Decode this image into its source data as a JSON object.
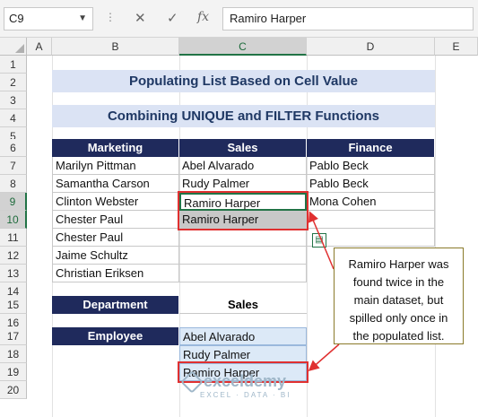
{
  "formula_bar": {
    "name_box": "C9",
    "cancel_glyph": "✕",
    "enter_glyph": "✓",
    "fx_label": "fx",
    "content": "Ramiro Harper"
  },
  "columns": [
    "A",
    "B",
    "C",
    "D",
    "E"
  ],
  "rows": [
    "1",
    "2",
    "3",
    "4",
    "5",
    "6",
    "7",
    "8",
    "9",
    "10",
    "11",
    "12",
    "13",
    "14",
    "15",
    "16",
    "17",
    "18",
    "19",
    "20"
  ],
  "titles": {
    "main": "Populating List Based on Cell Value",
    "sub": "Combining UNIQUE and FILTER Functions"
  },
  "table": {
    "headers": [
      "Marketing",
      "Sales",
      "Finance"
    ],
    "marketing": [
      "Marilyn Pittman",
      "Samantha Carson",
      "Clinton Webster",
      "Chester Paul",
      "Chester Paul",
      "Jaime Schultz",
      "Christian Eriksen"
    ],
    "sales": [
      "Abel Alvarado",
      "Rudy Palmer",
      "Ramiro Harper",
      "Ramiro Harper",
      "",
      "",
      ""
    ],
    "finance": [
      "Pablo Beck",
      "Pablo Beck",
      "Mona Cohen",
      "",
      "",
      "",
      ""
    ]
  },
  "lookup": {
    "department_label": "Department",
    "department_value": "Sales",
    "employee_label": "Employee",
    "employees": [
      "Abel Alvarado",
      "Rudy Palmer",
      "Ramiro Harper"
    ]
  },
  "callout": "Ramiro Harper was found twice in the main dataset, but spilled only once in the populated list.",
  "watermark": {
    "brand": "exceldemy",
    "tagline": "EXCEL · DATA · BI"
  },
  "colors": {
    "header_navy": "#1f2a5c",
    "title_band": "#dbe3f4",
    "spill_fill": "#dce9f7",
    "highlight_red": "#e03030",
    "excel_green": "#217346"
  }
}
